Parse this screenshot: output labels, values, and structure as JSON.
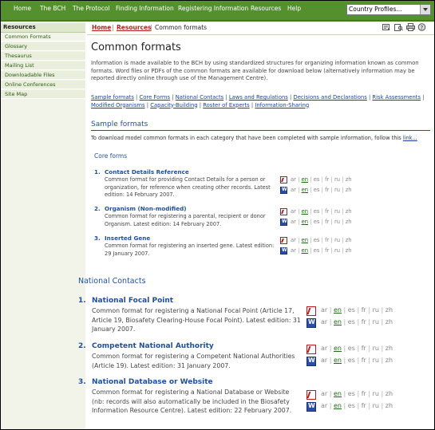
{
  "topnav": {
    "items": [
      "Home",
      "The BCH",
      "The Protocol",
      "Finding Information",
      "Registering Information",
      "Resources",
      "Help"
    ],
    "country_select": "Country Profiles..."
  },
  "sidebar": {
    "heading": "Resources",
    "items": [
      "Common Formats",
      "Glossary",
      "Thesaurus",
      "Mailing List",
      "Downloadable Files",
      "Online Conferences",
      "Site Map"
    ]
  },
  "breadcrumb": {
    "home": "Home",
    "sep": "|",
    "resources": "Resources",
    "current": "Common formats"
  },
  "toolbar_icons": [
    "email-page-icon",
    "print-preview-icon",
    "print-icon",
    "help-icon"
  ],
  "page": {
    "title": "Common formats",
    "intro": "Information is made available to the BCH by using standardized structures for organizing information known as common formats. Word files or PDFs of the common formats are available for download below (alternatively information may be reported directly online through use of the Management Centre).",
    "quicklinks": [
      "Sample formats",
      "Core Forms",
      "National Contacts",
      "Laws and Regulations",
      "Decisions and Declarations",
      "Risk Assessments",
      "Modified Organisms",
      "Capacity-Building",
      "Roster of Experts",
      "Information-Sharing"
    ]
  },
  "sample": {
    "title": "Sample formats",
    "desc": "To download model common formats in each category that have been completed with sample information, follow this ",
    "link": "link..."
  },
  "core": {
    "title": "Core forms",
    "items": [
      {
        "num": "1.",
        "title": "Contact Details Reference",
        "desc": "Common format for providing Contact Details for a person or organization, for reference when creating other records. Latest edition: 14 February 2007."
      },
      {
        "num": "2.",
        "title": "Organism (Non-modified)",
        "desc": "Common format for registering a parental, recipient or donor Organism. Latest edition: 14 February 2007."
      },
      {
        "num": "3.",
        "title": "Inserted Gene",
        "desc": "Common format for registering an inserted gene. Latest edition: 29 January 2007."
      }
    ]
  },
  "national": {
    "title": "National Contacts",
    "items": [
      {
        "num": "1.",
        "title": "National Focal Point",
        "desc": "Common format for registering a National Focal Point (Article 17, Article 19, Biosafety Clearing-House Focal Point). Latest edition: 31 January 2007."
      },
      {
        "num": "2.",
        "title": "Competent National Authority",
        "desc": "Common format for registering a Competent National Authorities (Article 19). Latest edition: 31 January 2007."
      },
      {
        "num": "3.",
        "title": "National Database or Website",
        "desc": "Common format for registering a National Database or Website (nb: records will also automatically be included in the Biosafety Information Resource Centre). Latest edition: 22 February 2007."
      }
    ]
  },
  "languages": [
    "ar",
    "en",
    "es",
    "fr",
    "ru",
    "zh"
  ],
  "colors": {
    "nav_green": "#55902f",
    "link_blue": "#1a3fa0",
    "heading_blue": "#1f4f9a",
    "breadcrumb_red": "#b3221f"
  }
}
